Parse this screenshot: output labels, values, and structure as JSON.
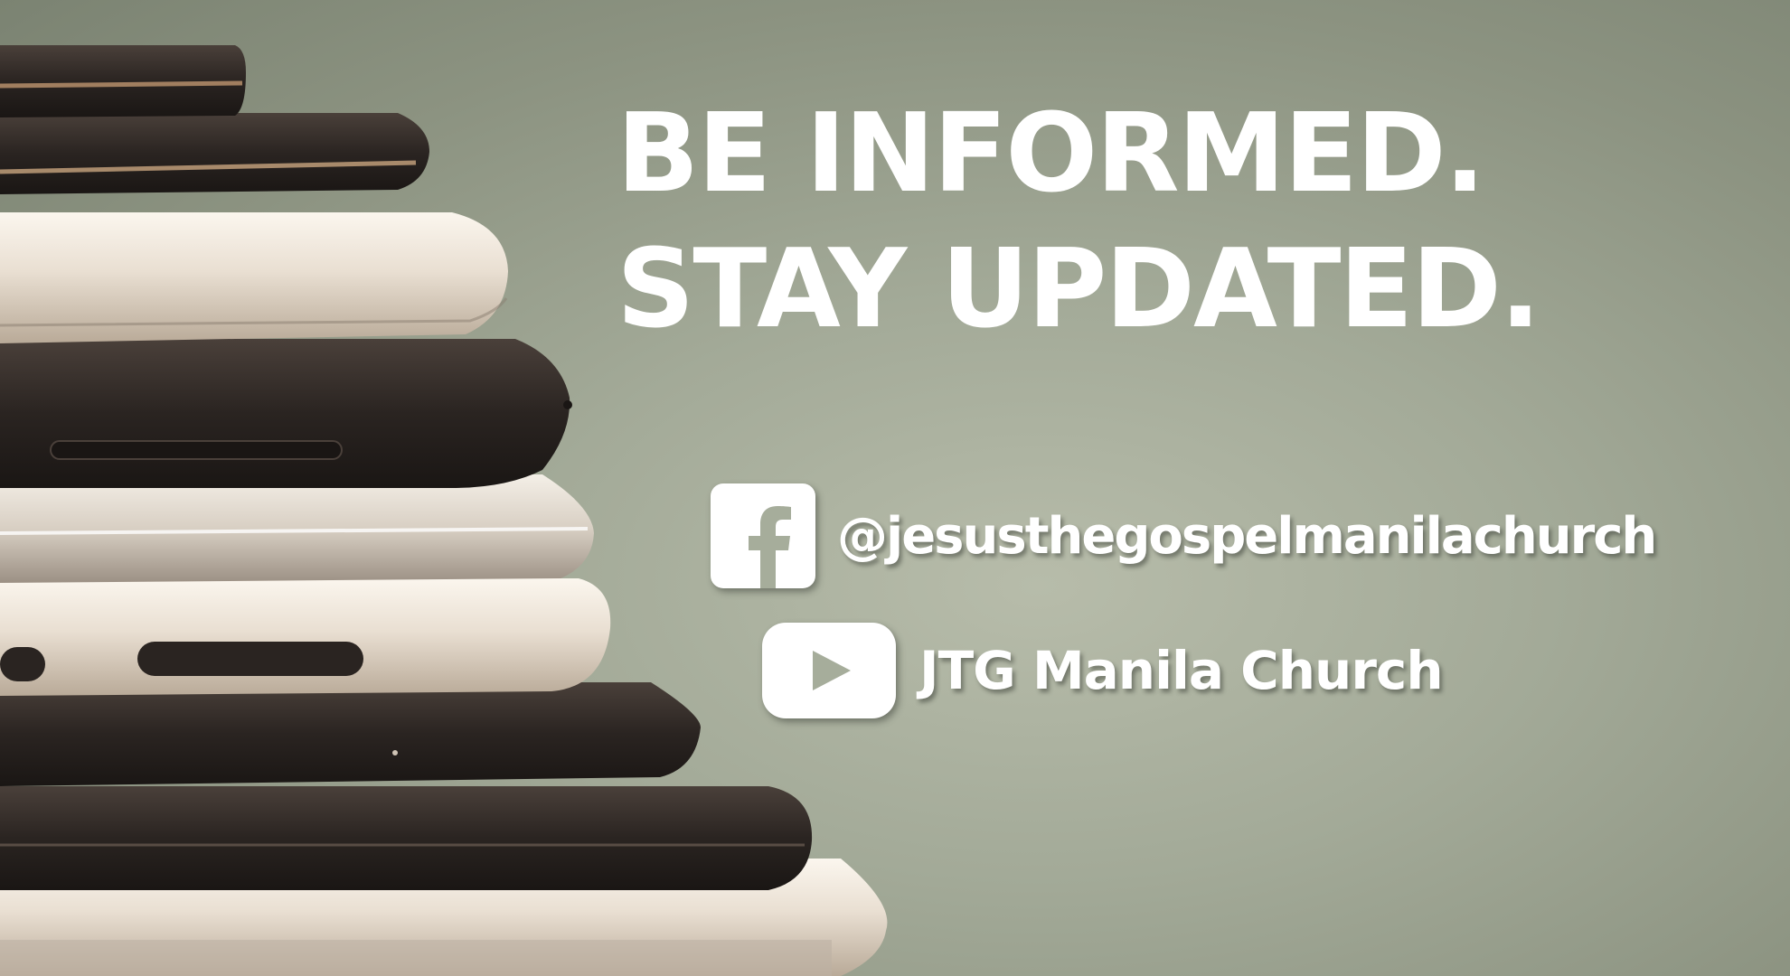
{
  "headline": {
    "line1": "BE INFORMED.",
    "line2": "STAY UPDATED."
  },
  "social": {
    "facebook": {
      "icon": "facebook-icon",
      "handle": "@jesusthegospelmanilachurch"
    },
    "youtube": {
      "icon": "youtube-play-icon",
      "channel": "JTG Manila Church"
    }
  },
  "colors": {
    "background": "#a3aa98",
    "text": "#ffffff"
  }
}
